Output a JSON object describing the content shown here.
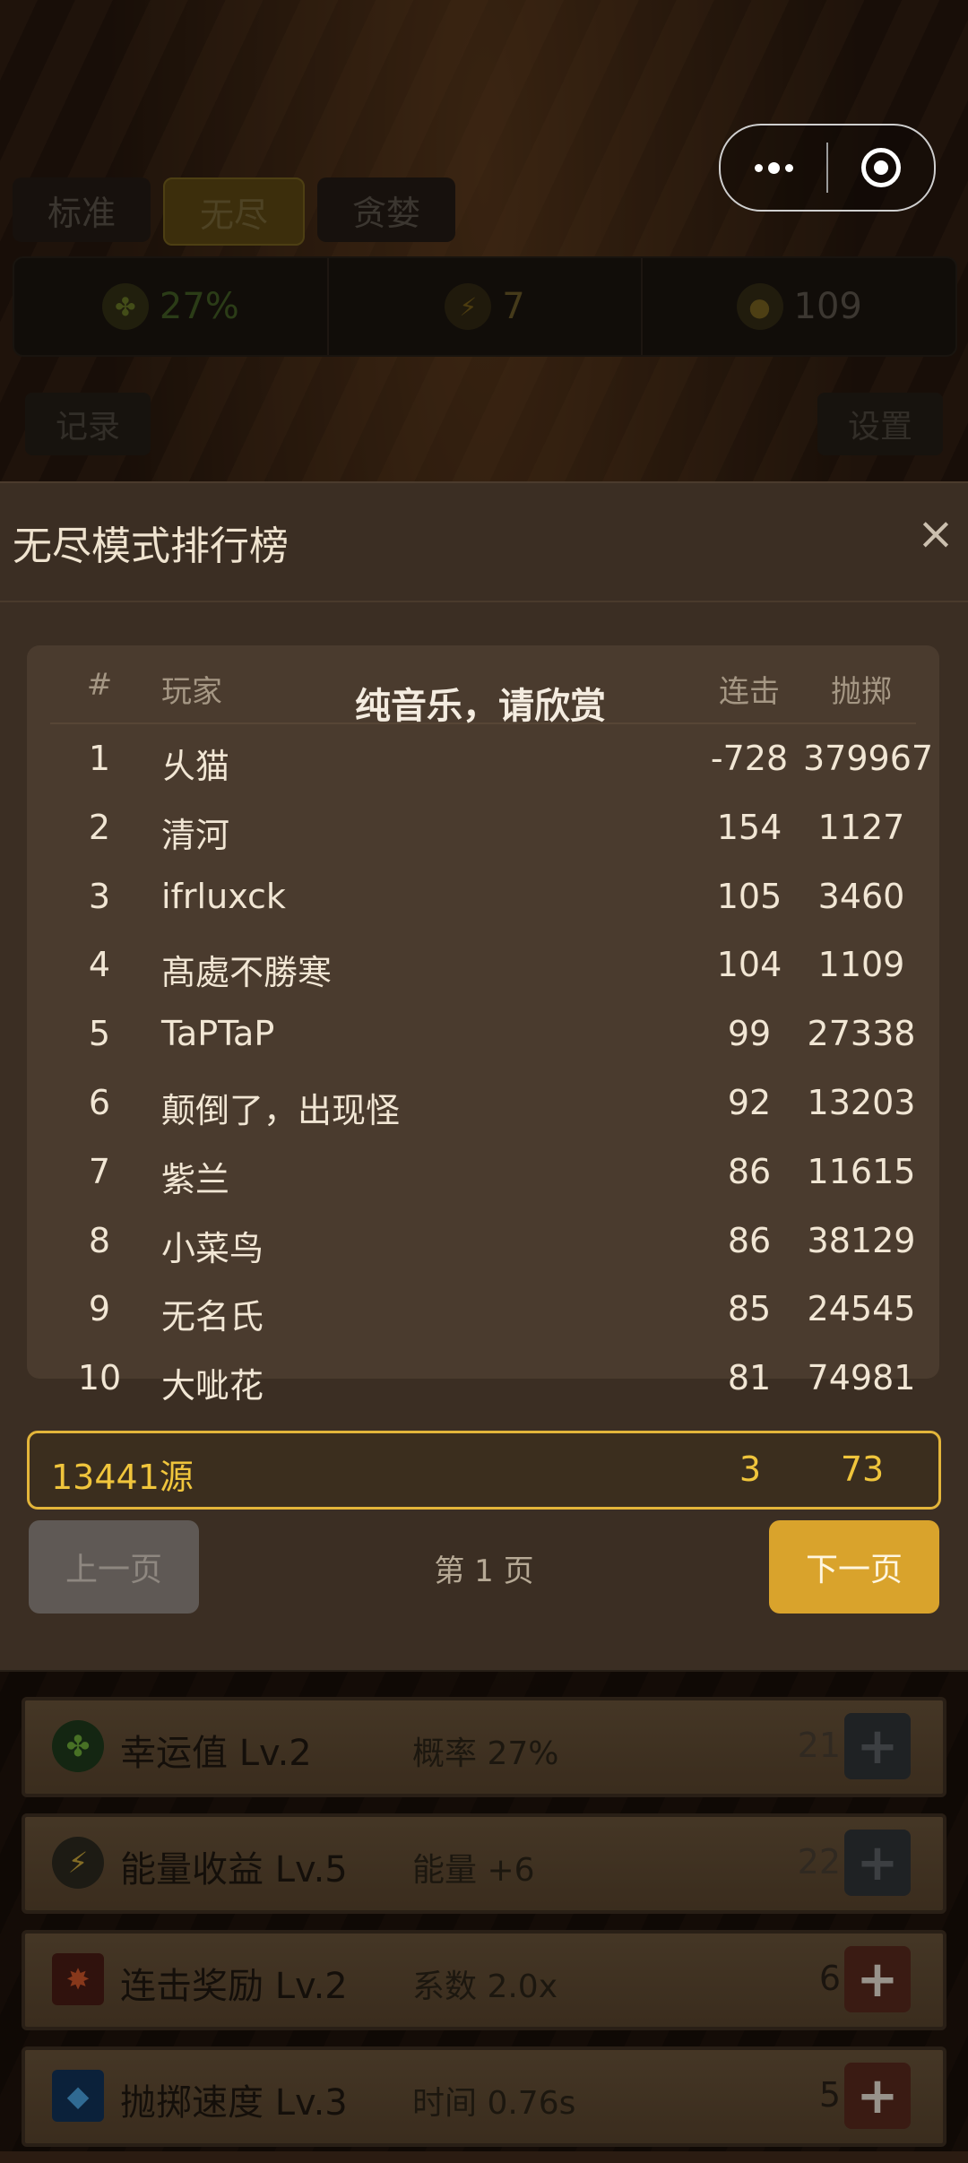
{
  "top": {
    "mode_tabs": [
      {
        "label": "标准"
      },
      {
        "label": "无尽",
        "active": true
      },
      {
        "label": "贪婪"
      }
    ],
    "stats": {
      "luck": {
        "icon": "clover-icon",
        "value": "27%"
      },
      "energy": {
        "icon": "lightning-icon",
        "value": "7"
      },
      "coins": {
        "icon": "coin-icon",
        "value": "109"
      }
    },
    "records_label": "记录",
    "settings_label": "设置"
  },
  "modal": {
    "title": "无尽模式排行榜",
    "close_icon": "close-icon",
    "overlay_text": "纯音乐，请欣赏",
    "columns": {
      "rank": "#",
      "player": "玩家",
      "combo": "连击",
      "throws": "抛掷"
    },
    "rows": [
      {
        "rank": "1",
        "player": "乆猫",
        "combo": "-728",
        "throws": "379967"
      },
      {
        "rank": "2",
        "player": "清河",
        "combo": "154",
        "throws": "1127"
      },
      {
        "rank": "3",
        "player": "ifrluxck",
        "combo": "105",
        "throws": "3460"
      },
      {
        "rank": "4",
        "player": "髙處不勝寒",
        "combo": "104",
        "throws": "1109"
      },
      {
        "rank": "5",
        "player": "TaPTaP",
        "combo": "99",
        "throws": "27338"
      },
      {
        "rank": "6",
        "player": "颠倒了，出现怪",
        "combo": "92",
        "throws": "13203"
      },
      {
        "rank": "7",
        "player": "紫兰",
        "combo": "86",
        "throws": "11615"
      },
      {
        "rank": "8",
        "player": "小菜鸟",
        "combo": "86",
        "throws": "38129"
      },
      {
        "rank": "9",
        "player": "无名氏",
        "combo": "85",
        "throws": "24545"
      },
      {
        "rank": "10",
        "player": "大呲花",
        "combo": "81",
        "throws": "74981"
      }
    ],
    "me": {
      "player": "13441源",
      "combo": "3",
      "throws": "73"
    },
    "prev_label": "上一页",
    "page_label": "第 1 页",
    "next_label": "下一页"
  },
  "upgrades": [
    {
      "icon": "clover-icon",
      "name": "幸运值 Lv.2",
      "effect": "概率 27%",
      "cost": "21",
      "affordable": false
    },
    {
      "icon": "energy-shield-icon",
      "name": "能量收益 Lv.5",
      "effect": "能量 +6",
      "cost": "22",
      "affordable": false
    },
    {
      "icon": "combo-burst-icon",
      "name": "连击奖励 Lv.2",
      "effect": "系数 2.0x",
      "cost": "6",
      "affordable": true
    },
    {
      "icon": "speed-cube-icon",
      "name": "抛掷速度 Lv.3",
      "effect": "时间 0.76s",
      "cost": "5",
      "affordable": true
    }
  ]
}
